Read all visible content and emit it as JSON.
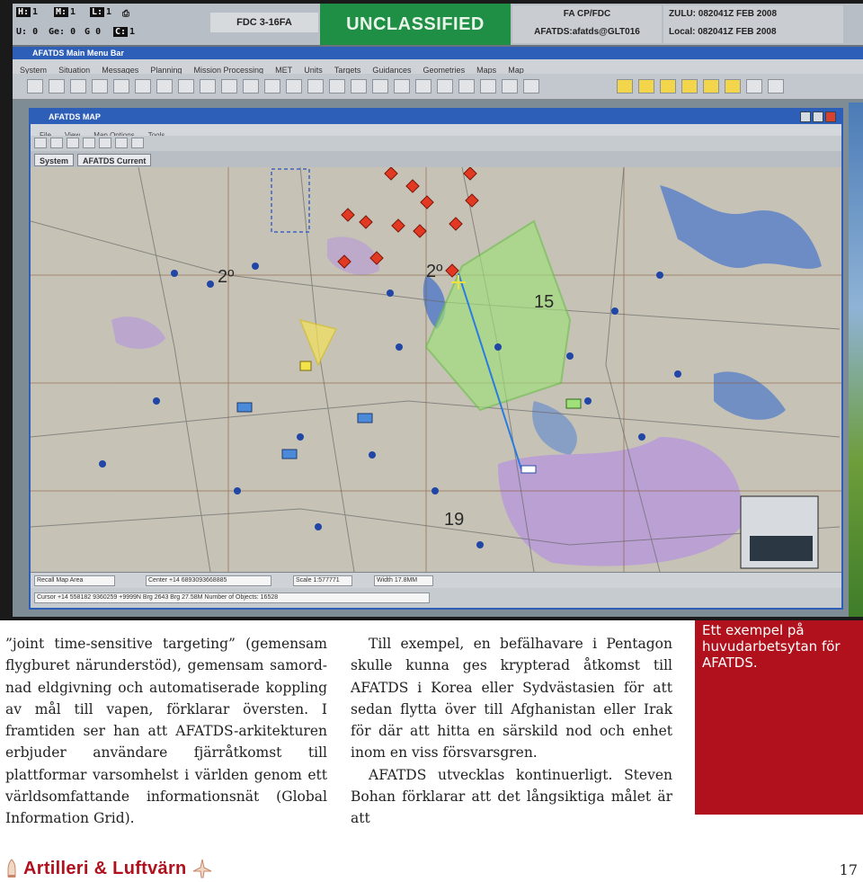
{
  "screen": {
    "status_keys": [
      {
        "key": "H:",
        "value": "1"
      },
      {
        "key": "M:",
        "value": "1"
      },
      {
        "key": "L:",
        "value": "1"
      },
      {
        "key": "U:",
        "value": "0"
      },
      {
        "key": "Ge:",
        "value": "0"
      },
      {
        "key": "G",
        "value": "0"
      },
      {
        "key": "C:",
        "value": "1"
      }
    ],
    "fdc_label": "FDC 3-16FA",
    "classification": "UNCLASSIFIED",
    "node_line1": "FA CP/FDC",
    "node_line2": "AFATDS:afatds@GLT016",
    "zulu": "ZULU: 082041Z FEB 2008",
    "local": "Local: 082041Z FEB 2008",
    "main_window_title": "AFATDS Main Menu Bar",
    "main_menu": [
      "System",
      "Situation",
      "Messages",
      "Planning",
      "Mission Processing",
      "MET",
      "Units",
      "Targets",
      "Guidances",
      "Geometries",
      "Maps",
      "Map"
    ],
    "map_window_title": "AFATDS MAP",
    "map_menu": [
      "File",
      "View",
      "Map Options",
      "Tools"
    ],
    "map_tabs": [
      "System",
      "AFATDS Current"
    ],
    "map_labels": [
      "2º",
      "15",
      "19",
      "2º"
    ],
    "status_fields": [
      "Recall Map Area",
      "Center +14 6893093668885",
      "Scale 1:577771",
      "Width 17.8MM"
    ],
    "status_line2": "Cursor +14 558182 9360259 +9999N Brg 2643 Brg 27.58M Number of Objects: 16528",
    "colors": {
      "classification_bg": "#1f8f45",
      "window_title_bg": "#2d5fb8",
      "sector_fill": "#9fe07a",
      "hostile_marker": "#e23a22"
    }
  },
  "article": {
    "col1": "”joint time-sensitive targeting” (gemensam flygburet närunderstöd), gemensam samord­nad eldgivning och automatiserade koppling av mål till vapen, förklarar översten. I framtiden ser han att AFATDS-arkitekturen erbjuder användare fjärråtkomst till plattformar var­somhelst i världen genom ett världsomfattande informationsnät (Global Information Grid).",
    "col2_p1": "Till exempel, en befälhavare i Pentagon skulle kunna ges krypterad åtkomst till AFAT­DS i Korea eller Sydvästasien för att sedan flytta över till Afghanistan eller Irak för där att hitta en särskild nod och enhet inom en viss försvarsgren.",
    "col2_p2": "AFATDS utvecklas kontinuerligt. Steven Bohan förklarar att det långsiktiga målet är att"
  },
  "caption": "Ett exempel på huvudarbetsytan för AFATDS.",
  "footer": {
    "magazine": "Artilleri & Luftvärn",
    "page": "17"
  }
}
